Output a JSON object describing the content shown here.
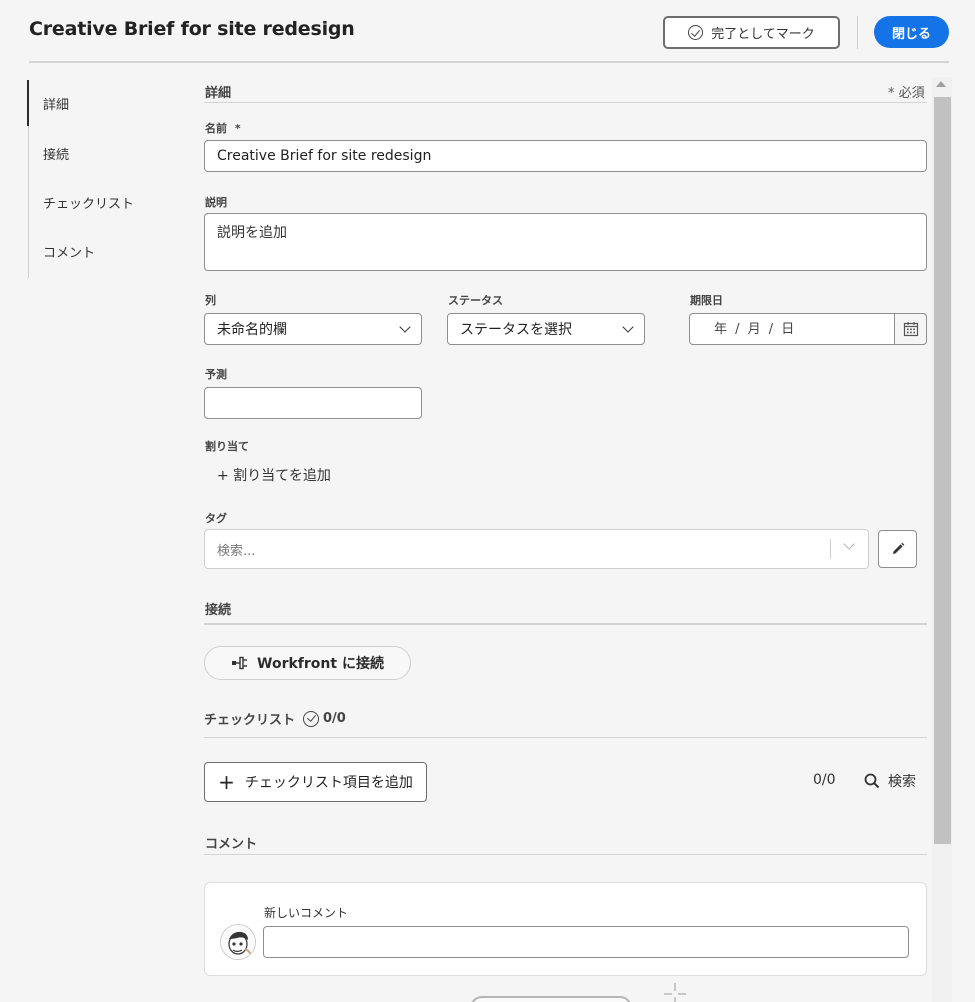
{
  "header": {
    "title": "Creative Brief for site redesign",
    "mark_complete_label": "完了としてマーク",
    "close_label": "閉じる"
  },
  "nav": {
    "items": [
      {
        "label": "詳細",
        "active": true
      },
      {
        "label": "接続",
        "active": false
      },
      {
        "label": "チェックリスト",
        "active": false
      },
      {
        "label": "コメント",
        "active": false
      }
    ]
  },
  "details": {
    "heading": "詳細",
    "required_note": "* 必須",
    "name_label": "名前",
    "name_required": "*",
    "name_value": "Creative Brief for site redesign",
    "description_label": "説明",
    "description_placeholder": "説明を追加",
    "column_label": "列",
    "column_value": "未命名的欄",
    "status_label": "ステータス",
    "status_value": "ステータスを選択",
    "due_label": "期限日",
    "due_placeholder": "年 / 月 / 日",
    "estimate_label": "予測",
    "estimate_value": "",
    "assign_label": "割り当て",
    "assign_add": "+ 割り当てを追加",
    "tags_label": "タグ",
    "tags_placeholder": "検索..."
  },
  "connections": {
    "heading": "接続",
    "workfront_label": "Workfront に接続"
  },
  "checklist": {
    "heading": "チェックリスト",
    "progress": "0/0",
    "add_label": "チェックリスト項目を追加",
    "count": "0/0",
    "search_label": "検索"
  },
  "comments": {
    "heading": "コメント",
    "new_comment_label": "新しいコメント",
    "new_comment_value": ""
  },
  "colors": {
    "accent": "#1473e6",
    "background": "#f5f5f5",
    "scroll_thumb": "#c1c1c1"
  }
}
